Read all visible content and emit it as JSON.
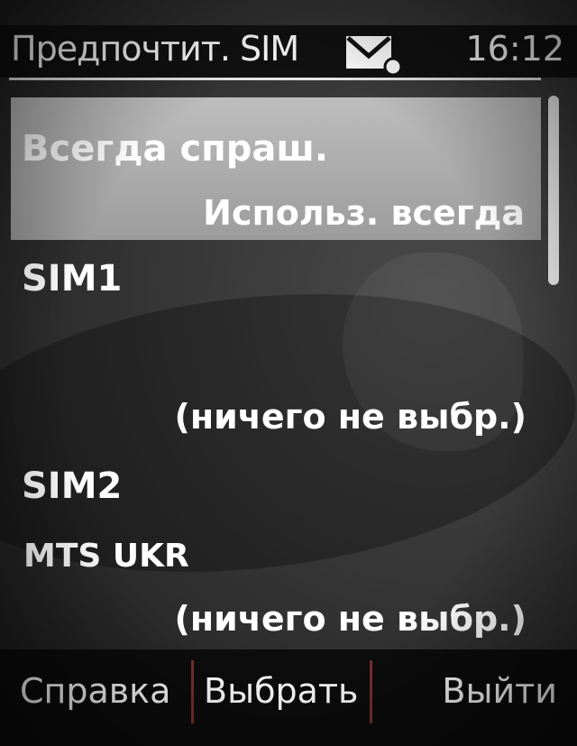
{
  "status_bar": {
    "title": "Предпочтит. SIM",
    "time": "16:12",
    "message_icon": "envelope-icon"
  },
  "list": {
    "items": [
      {
        "title": "Всегда спраш.",
        "subtitle": "Использ. всегда",
        "selected": true
      },
      {
        "title": "SIM1",
        "subtitle": "(ничего не выбр.)"
      },
      {
        "title": "SIM2",
        "operator": "MTS UKR",
        "subtitle": "(ничего не выбр.)"
      }
    ]
  },
  "softkeys": {
    "left": "Справка",
    "middle": "Выбрать",
    "right": "Выйти"
  },
  "colors": {
    "highlight": "#a9a9a9",
    "background": "#2a2a2a",
    "text": "#ffffff",
    "separator": "#7a3030"
  }
}
